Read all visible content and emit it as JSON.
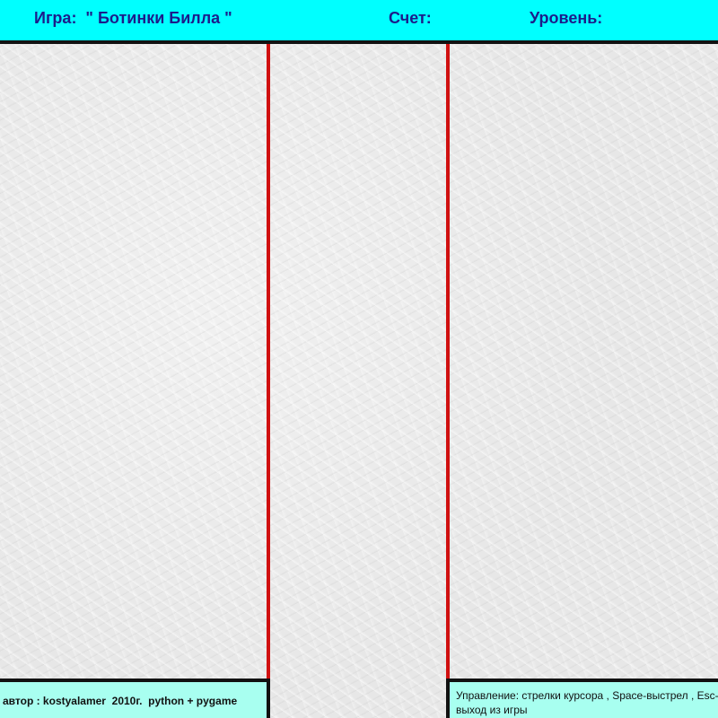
{
  "hud": {
    "title": "Игра:  \" Ботинки Билла \"",
    "score_label": "Счет:",
    "level_label": "Уровень:"
  },
  "footer": {
    "credits": "автор : kostyalamer  2010г.  python + pygame",
    "controls": "Управление: стрелки курсора , Space-выстрел , Esc- выход из игры"
  },
  "colors": {
    "hud_background": "#00ffff",
    "hud_text": "#1c1c8a",
    "lane_line": "#d01010",
    "footer_background": "#a8fff0",
    "field": "#e7e7e7"
  }
}
